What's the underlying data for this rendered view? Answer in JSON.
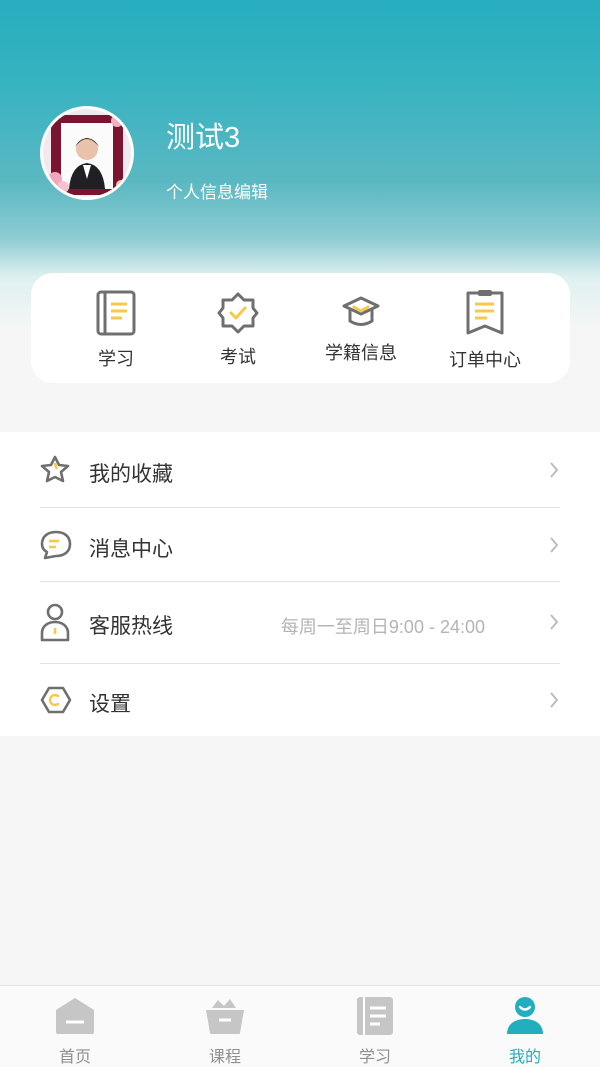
{
  "profile": {
    "username": "测试3",
    "edit_label": "个人信息编辑"
  },
  "quick_actions": [
    {
      "label": "学习",
      "icon": "study-book-icon"
    },
    {
      "label": "考试",
      "icon": "exam-badge-icon"
    },
    {
      "label": "学籍信息",
      "icon": "graduation-cap-icon"
    },
    {
      "label": "订单中心",
      "icon": "clipboard-icon"
    }
  ],
  "menu": [
    {
      "label": "我的收藏",
      "icon": "star-icon",
      "sub": ""
    },
    {
      "label": "消息中心",
      "icon": "message-icon",
      "sub": ""
    },
    {
      "label": "客服热线",
      "icon": "customer-service-icon",
      "sub": "每周一至周日9:00 - 24:00"
    },
    {
      "label": "设置",
      "icon": "settings-hexagon-icon",
      "sub": ""
    }
  ],
  "tabbar": [
    {
      "label": "首页",
      "icon": "home-icon",
      "active": false
    },
    {
      "label": "课程",
      "icon": "course-basket-icon",
      "active": false
    },
    {
      "label": "学习",
      "icon": "study-notes-icon",
      "active": false
    },
    {
      "label": "我的",
      "icon": "profile-icon",
      "active": true
    }
  ],
  "colors": {
    "accent": "#22aebf",
    "highlight": "#f6c94a",
    "icon_gray": "#6f6f6f"
  }
}
